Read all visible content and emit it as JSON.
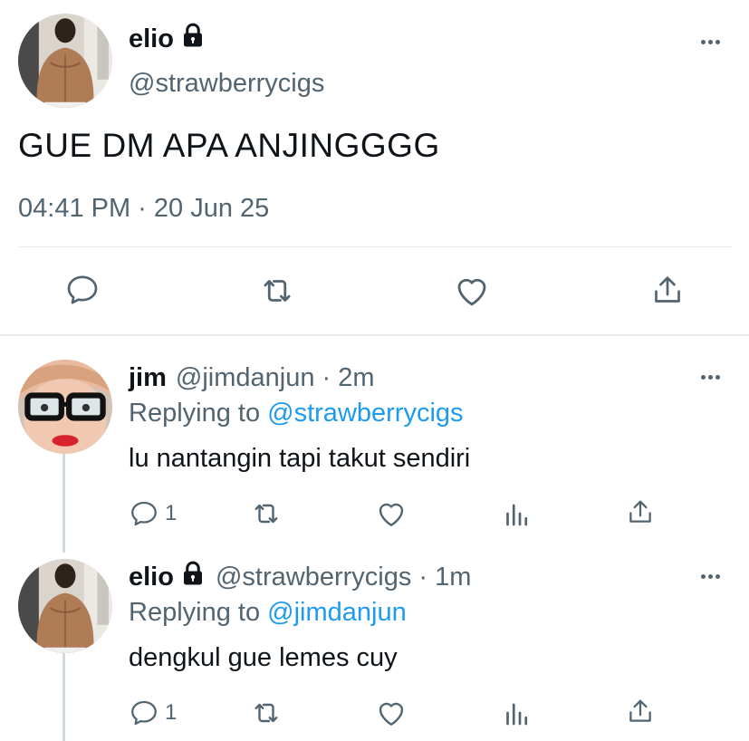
{
  "main_tweet": {
    "display_name": "elio",
    "handle": "@strawberrycigs",
    "text": "GUE DM APA ANJINGGGG",
    "timestamp": "04:41 PM · 20 Jun 25",
    "avatar_icon": "shirtless-man-avatar",
    "lock_icon": "lock-icon",
    "actions": [
      "reply-icon",
      "retweet-icon",
      "like-icon",
      "share-icon"
    ]
  },
  "replies": [
    {
      "display_name": "jim",
      "handle_time": "@jimdanjun · 2m",
      "replying_label": "Replying to ",
      "replying_to": "@strawberrycigs",
      "text": "lu nantangin tapi takut sendiri",
      "reply_count": "1",
      "avatar_icon": "glasses-person-avatar"
    },
    {
      "display_name": "elio",
      "handle_time": "@strawberrycigs · 1m",
      "replying_label": "Replying to ",
      "replying_to": "@jimdanjun",
      "text": "dengkul gue lemes cuy",
      "reply_count": "1",
      "avatar_icon": "shirtless-man-avatar"
    }
  ],
  "colors": {
    "link": "#1d9bf0",
    "secondary": "#536471",
    "divider": "#e6ecf0",
    "thread_line": "#cfd9de"
  }
}
